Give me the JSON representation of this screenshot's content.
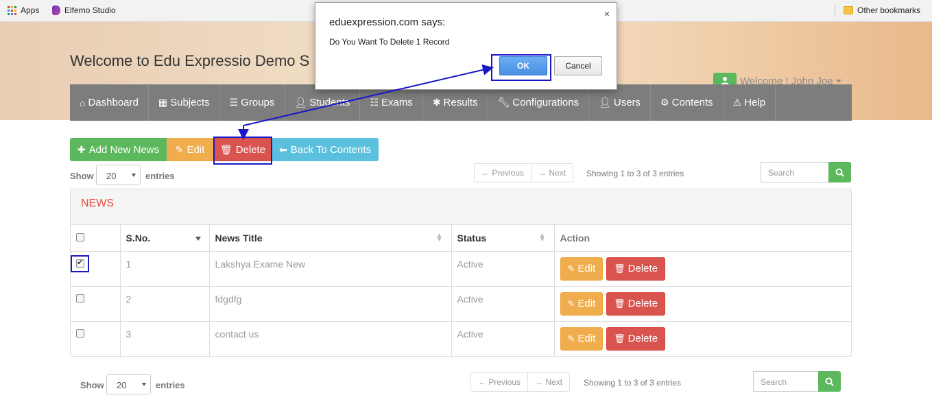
{
  "bookmarks": {
    "apps": "Apps",
    "elfemo": "Elfemo Studio",
    "other": "Other bookmarks"
  },
  "header": {
    "title": "Welcome to Edu Expressio Demo S",
    "welcome": "Welcome ! John Joe"
  },
  "nav": [
    {
      "label": "Dashboard",
      "icon": "home-icon"
    },
    {
      "label": "Subjects",
      "icon": "grid-icon"
    },
    {
      "label": "Groups",
      "icon": "list-icon"
    },
    {
      "label": "Students",
      "icon": "user-icon"
    },
    {
      "label": "Exams",
      "icon": "list-alt-icon"
    },
    {
      "label": "Results",
      "icon": "asterisk-icon"
    },
    {
      "label": "Configurations",
      "icon": "wrench-icon"
    },
    {
      "label": "Users",
      "icon": "user-icon"
    },
    {
      "label": "Contents",
      "icon": "cog-icon"
    },
    {
      "label": "Help",
      "icon": "warning-icon"
    }
  ],
  "toolbar": {
    "add": "Add New News",
    "edit": "Edit",
    "delete": "Delete",
    "back": "Back To Contents"
  },
  "controls": {
    "show": "Show",
    "entries": "entries",
    "page_size": "20",
    "previous": "← Previous",
    "next": "→ Next",
    "info": "Showing 1 to 3 of 3 entries",
    "search_placeholder": "Search"
  },
  "panel": {
    "title": "NEWS",
    "headers": {
      "sno": "S.No.",
      "title": "News Title",
      "status": "Status",
      "action": "Action"
    },
    "rows": [
      {
        "sno": "1",
        "title": "Lakshya Exame New",
        "status": "Active",
        "checked": true
      },
      {
        "sno": "2",
        "title": "fdgdfg",
        "status": "Active",
        "checked": false
      },
      {
        "sno": "3",
        "title": "contact us",
        "status": "Active",
        "checked": false
      }
    ],
    "row_edit": "Edit",
    "row_delete": "Delete"
  },
  "dialog": {
    "title": "eduexpression.com says:",
    "message": "Do You Want To Delete 1 Record",
    "ok": "OK",
    "cancel": "Cancel",
    "close": "×"
  },
  "colors": {
    "green": "#5cb85c",
    "orange": "#f0ad4e",
    "red": "#d9534f",
    "blue": "#5bc0de",
    "nav": "#7d7d7d",
    "annotation": "#1818c8"
  }
}
